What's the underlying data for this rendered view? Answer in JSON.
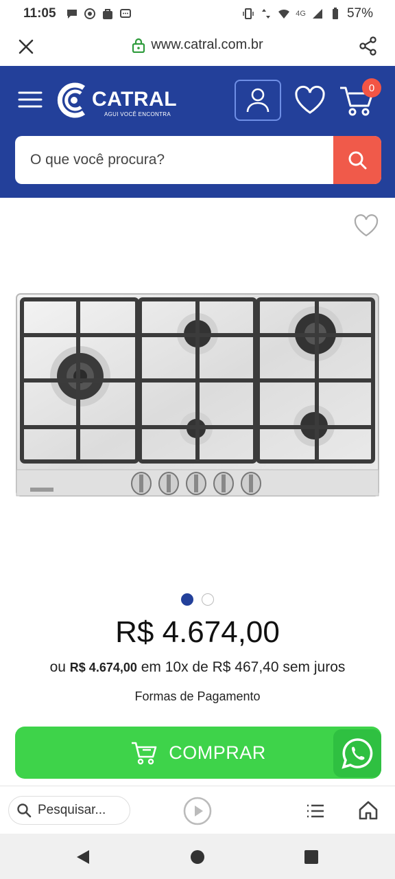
{
  "status_bar": {
    "time": "11:05",
    "network": "4G",
    "battery": "57%",
    "icons": [
      "chat-icon",
      "whatsapp-icon",
      "shopping-bag-icon",
      "message-icon",
      "vibrate-icon",
      "data-arrows-icon",
      "wifi-icon",
      "signal-icon",
      "battery-icon"
    ]
  },
  "browser": {
    "url": "www.catral.com.br",
    "close_icon": "close-icon",
    "lock_icon": "lock-icon",
    "share_icon": "share-icon"
  },
  "header": {
    "brand_name": "CATRAL",
    "brand_tagline": "AGUI VOCÊ ENCONTRA",
    "cart_count": "0",
    "colors": {
      "header_bg": "#23409a",
      "search_button": "#f05a4a",
      "badge": "#f25545"
    }
  },
  "search": {
    "placeholder": "O que você procura?"
  },
  "product": {
    "image_alt": "Cooktop a gás inox 5 bocas",
    "image_count": 2,
    "active_image": 1,
    "price": "R$ 4.674,00",
    "installment_prefix": "ou",
    "installment_total": "R$ 4.674,00",
    "installment_rest": "em 10x de R$ 467,40 sem juros",
    "payment_methods_label": "Formas de Pagamento",
    "buy_label": "COMPRAR",
    "colors": {
      "buy_button": "#3ed34a",
      "whatsapp": "#2fc041"
    }
  },
  "bottom_toolbar": {
    "search_label": "Pesquisar...",
    "icons": [
      "search-icon",
      "play-icon",
      "list-icon",
      "home-icon"
    ]
  }
}
